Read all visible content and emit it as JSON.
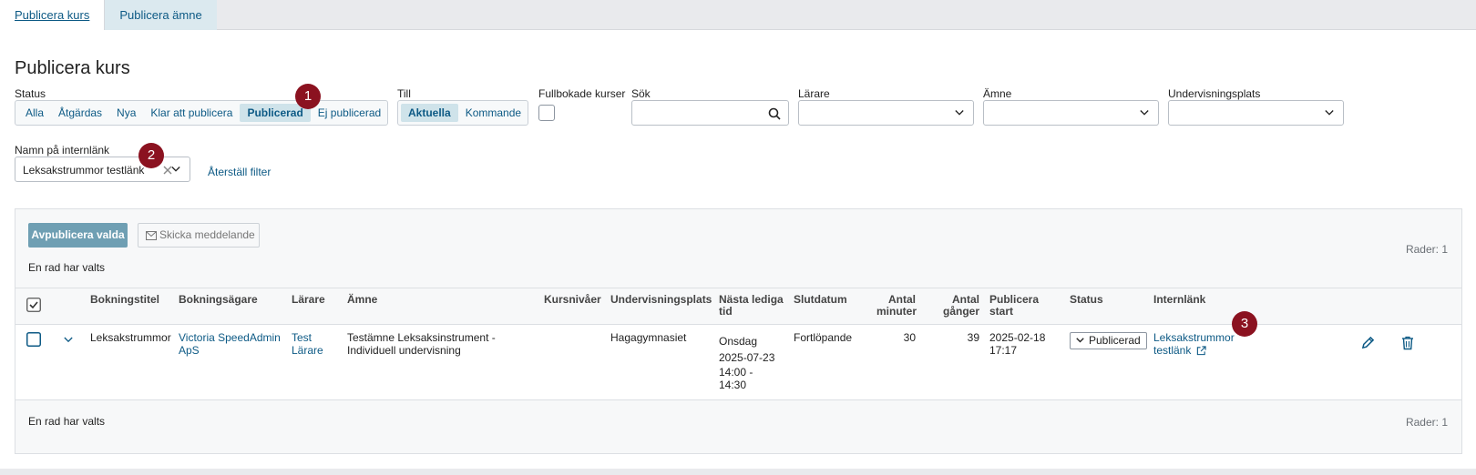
{
  "tabs": [
    {
      "label": "Publicera kurs"
    },
    {
      "label": "Publicera ämne"
    }
  ],
  "page_title": "Publicera kurs",
  "filters": {
    "status_label": "Status",
    "status_options": [
      "Alla",
      "Åtgärdas",
      "Nya",
      "Klar att publicera",
      "Publicerad",
      "Ej publicerad"
    ],
    "status_selected": "Publicerad",
    "till_label": "Till",
    "till_options": [
      "Aktuella",
      "Kommande"
    ],
    "till_selected": "Aktuella",
    "fullbokade_label": "Fullbokade kurser",
    "sok_label": "Sök",
    "sok_value": "",
    "larare_label": "Lärare",
    "larare_value": "",
    "amne_label": "Ämne",
    "amne_value": "",
    "undervisningsplats_label": "Undervisningsplats",
    "undervisningsplats_value": "",
    "internlank_label": "Namn på internlänk",
    "internlank_value": "Leksakstrummor testlänk",
    "reset_label": "Återställ filter"
  },
  "markers": [
    "1",
    "2",
    "3"
  ],
  "actions": {
    "unpublish_label": "Avpublicera valda",
    "message_label": "Skicka meddelande",
    "selected_text": "En rad har valts",
    "rows_text": "Rader: 1"
  },
  "table": {
    "headers": {
      "bokningstitel": "Bokningstitel",
      "bokningsagare": "Bokningsägare",
      "larare": "Lärare",
      "amne": "Ämne",
      "kursnivaer": "Kursnivåer",
      "undervisningsplats": "Undervisningsplats",
      "nasta_ledig_1": "Nästa lediga",
      "nasta_ledig_2": "tid",
      "slutdatum": "Slutdatum",
      "antal_min_1": "Antal",
      "antal_min_2": "minuter",
      "antal_gang_1": "Antal",
      "antal_gang_2": "gånger",
      "pub_start_1": "Publicera",
      "pub_start_2": "start",
      "status": "Status",
      "internlank": "Internlänk"
    },
    "row": {
      "bokningstitel": "Leksakstrummor",
      "bokningsagare_1": "Victoria SpeedAdmin",
      "bokningsagare_2": "ApS",
      "larare_1": "Test",
      "larare_2": "Lärare",
      "amne_1": "Testämne Leksaksinstrument -",
      "amne_2": "Individuell undervisning",
      "undervisningsplats": "Hagagymnasiet",
      "nasta_day": "Onsdag",
      "nasta_date": "2025-07-23",
      "nasta_time_1": "14:00 -",
      "nasta_time_2": "14:30",
      "slutdatum": "Fortlöpande",
      "antal_minuter": "30",
      "antal_ganger": "39",
      "pub_date": "2025-02-18",
      "pub_time": "17:17",
      "status": "Publicerad",
      "internlank_1": "Leksakstrummor",
      "internlank_2": "testlänk"
    }
  },
  "icons": {
    "search": "search-icon",
    "chevron": "chevron-down-icon",
    "clear": "close-icon",
    "mail": "envelope-icon",
    "edit": "pencil-icon",
    "delete": "trash-icon",
    "external": "external-link-icon"
  },
  "colors": {
    "link": "#0d5a85",
    "marker": "#8b1220",
    "primary_button": "#6f9fb3",
    "segment_selected": "#cfe3ea"
  }
}
